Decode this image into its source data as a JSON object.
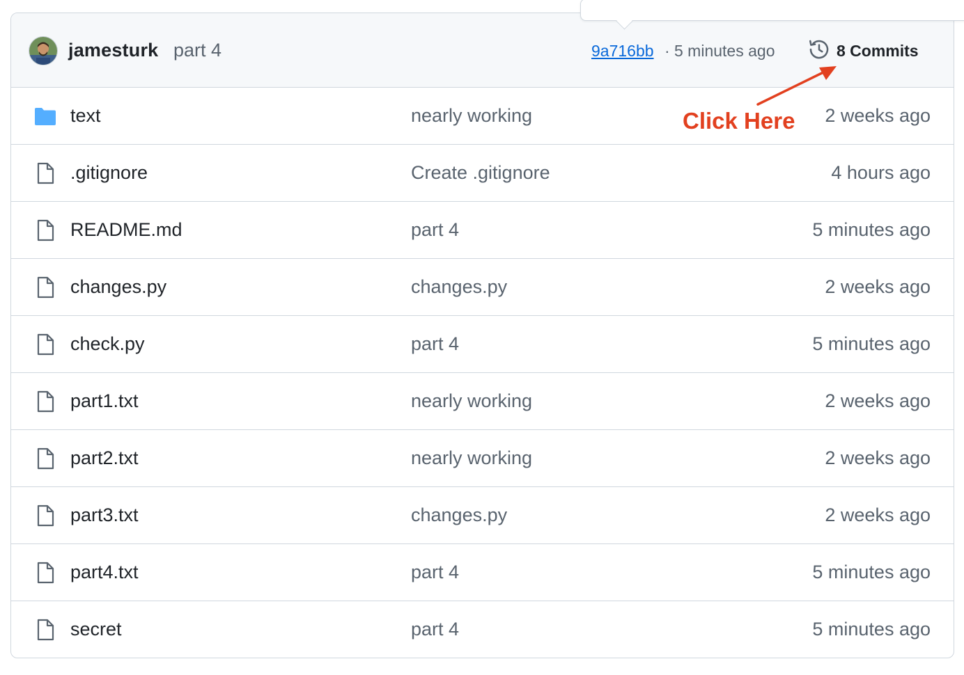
{
  "latest_commit": {
    "author": "jamesturk",
    "message": "part 4",
    "sha": "9a716bb",
    "separator": "·",
    "time": "5 minutes ago",
    "commits_count_label": "8 Commits"
  },
  "annotation": {
    "text": "Click Here",
    "color": "#e2401f"
  },
  "files": [
    {
      "type": "folder",
      "icon": "folder-icon",
      "name": "text",
      "message": "nearly working",
      "time": "2 weeks ago"
    },
    {
      "type": "file",
      "icon": "file-icon",
      "name": ".gitignore",
      "message": "Create .gitignore",
      "time": "4 hours ago"
    },
    {
      "type": "file",
      "icon": "file-icon",
      "name": "README.md",
      "message": "part 4",
      "time": "5 minutes ago"
    },
    {
      "type": "file",
      "icon": "file-icon",
      "name": "changes.py",
      "message": "changes.py",
      "time": "2 weeks ago"
    },
    {
      "type": "file",
      "icon": "file-icon",
      "name": "check.py",
      "message": "part 4",
      "time": "5 minutes ago"
    },
    {
      "type": "file",
      "icon": "file-icon",
      "name": "part1.txt",
      "message": "nearly working",
      "time": "2 weeks ago"
    },
    {
      "type": "file",
      "icon": "file-icon",
      "name": "part2.txt",
      "message": "nearly working",
      "time": "2 weeks ago"
    },
    {
      "type": "file",
      "icon": "file-icon",
      "name": "part3.txt",
      "message": "changes.py",
      "time": "2 weeks ago"
    },
    {
      "type": "file",
      "icon": "file-icon",
      "name": "part4.txt",
      "message": "part 4",
      "time": "5 minutes ago"
    },
    {
      "type": "file",
      "icon": "file-icon",
      "name": "secret",
      "message": "part 4",
      "time": "5 minutes ago"
    }
  ],
  "colors": {
    "link": "#0969da",
    "folder": "#54aeff",
    "muted_text": "#59636e",
    "text": "#1f2328",
    "border": "#d0d7de",
    "header_bg": "#f6f8fa"
  }
}
